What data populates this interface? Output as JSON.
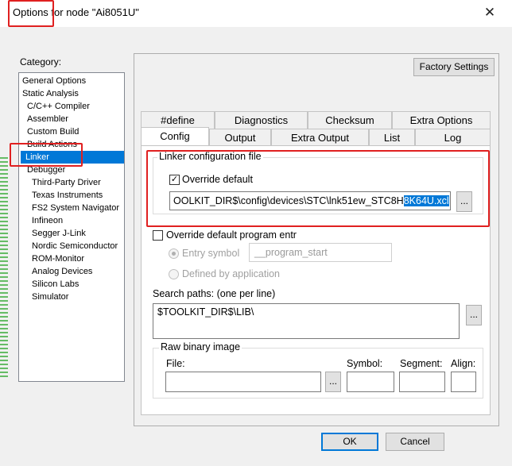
{
  "window": {
    "title": "Options for node \"Ai8051U\"",
    "close_glyph": "✕"
  },
  "category_label": "Category:",
  "categories": [
    "General Options",
    "Static Analysis",
    "C/C++ Compiler",
    "Assembler",
    "Custom Build",
    "Build Actions",
    "Linker",
    "Debugger",
    "Third-Party Driver",
    "Texas Instruments",
    "FS2 System Navigator",
    "Infineon",
    "Segger J-Link",
    "Nordic Semiconductor",
    "ROM-Monitor",
    "Analog Devices",
    "Silicon Labs",
    "Simulator"
  ],
  "selected_category": "Linker",
  "factory_settings": "Factory Settings",
  "tabs_back": [
    "#define",
    "Diagnostics",
    "Checksum",
    "Extra Options"
  ],
  "tabs_front": [
    "Config",
    "Output",
    "Extra Output",
    "List",
    "Log"
  ],
  "active_tab": "Config",
  "linker_config": {
    "legend": "Linker configuration file",
    "override_label": "Override default",
    "override_checked": true,
    "path_plain": "OOLKIT_DIR$\\config\\devices\\STC\\lnk51ew_STC8H",
    "path_selected": "8K64U.xcl"
  },
  "entry": {
    "override_label": "Override default program entr",
    "entry_symbol_label": "Entry symbol",
    "entry_symbol_value": "__program_start",
    "defined_by_app_label": "Defined by application"
  },
  "search": {
    "label": "Search paths:  (one per line)",
    "value": "$TOOLKIT_DIR$\\LIB\\"
  },
  "raw_binary": {
    "legend": "Raw binary image",
    "file_label": "File:",
    "symbol_label": "Symbol:",
    "segment_label": "Segment:",
    "align_label": "Align:"
  },
  "ellipsis": "...",
  "footer": {
    "ok": "OK",
    "cancel": "Cancel"
  },
  "annotation_color": "#e02020"
}
